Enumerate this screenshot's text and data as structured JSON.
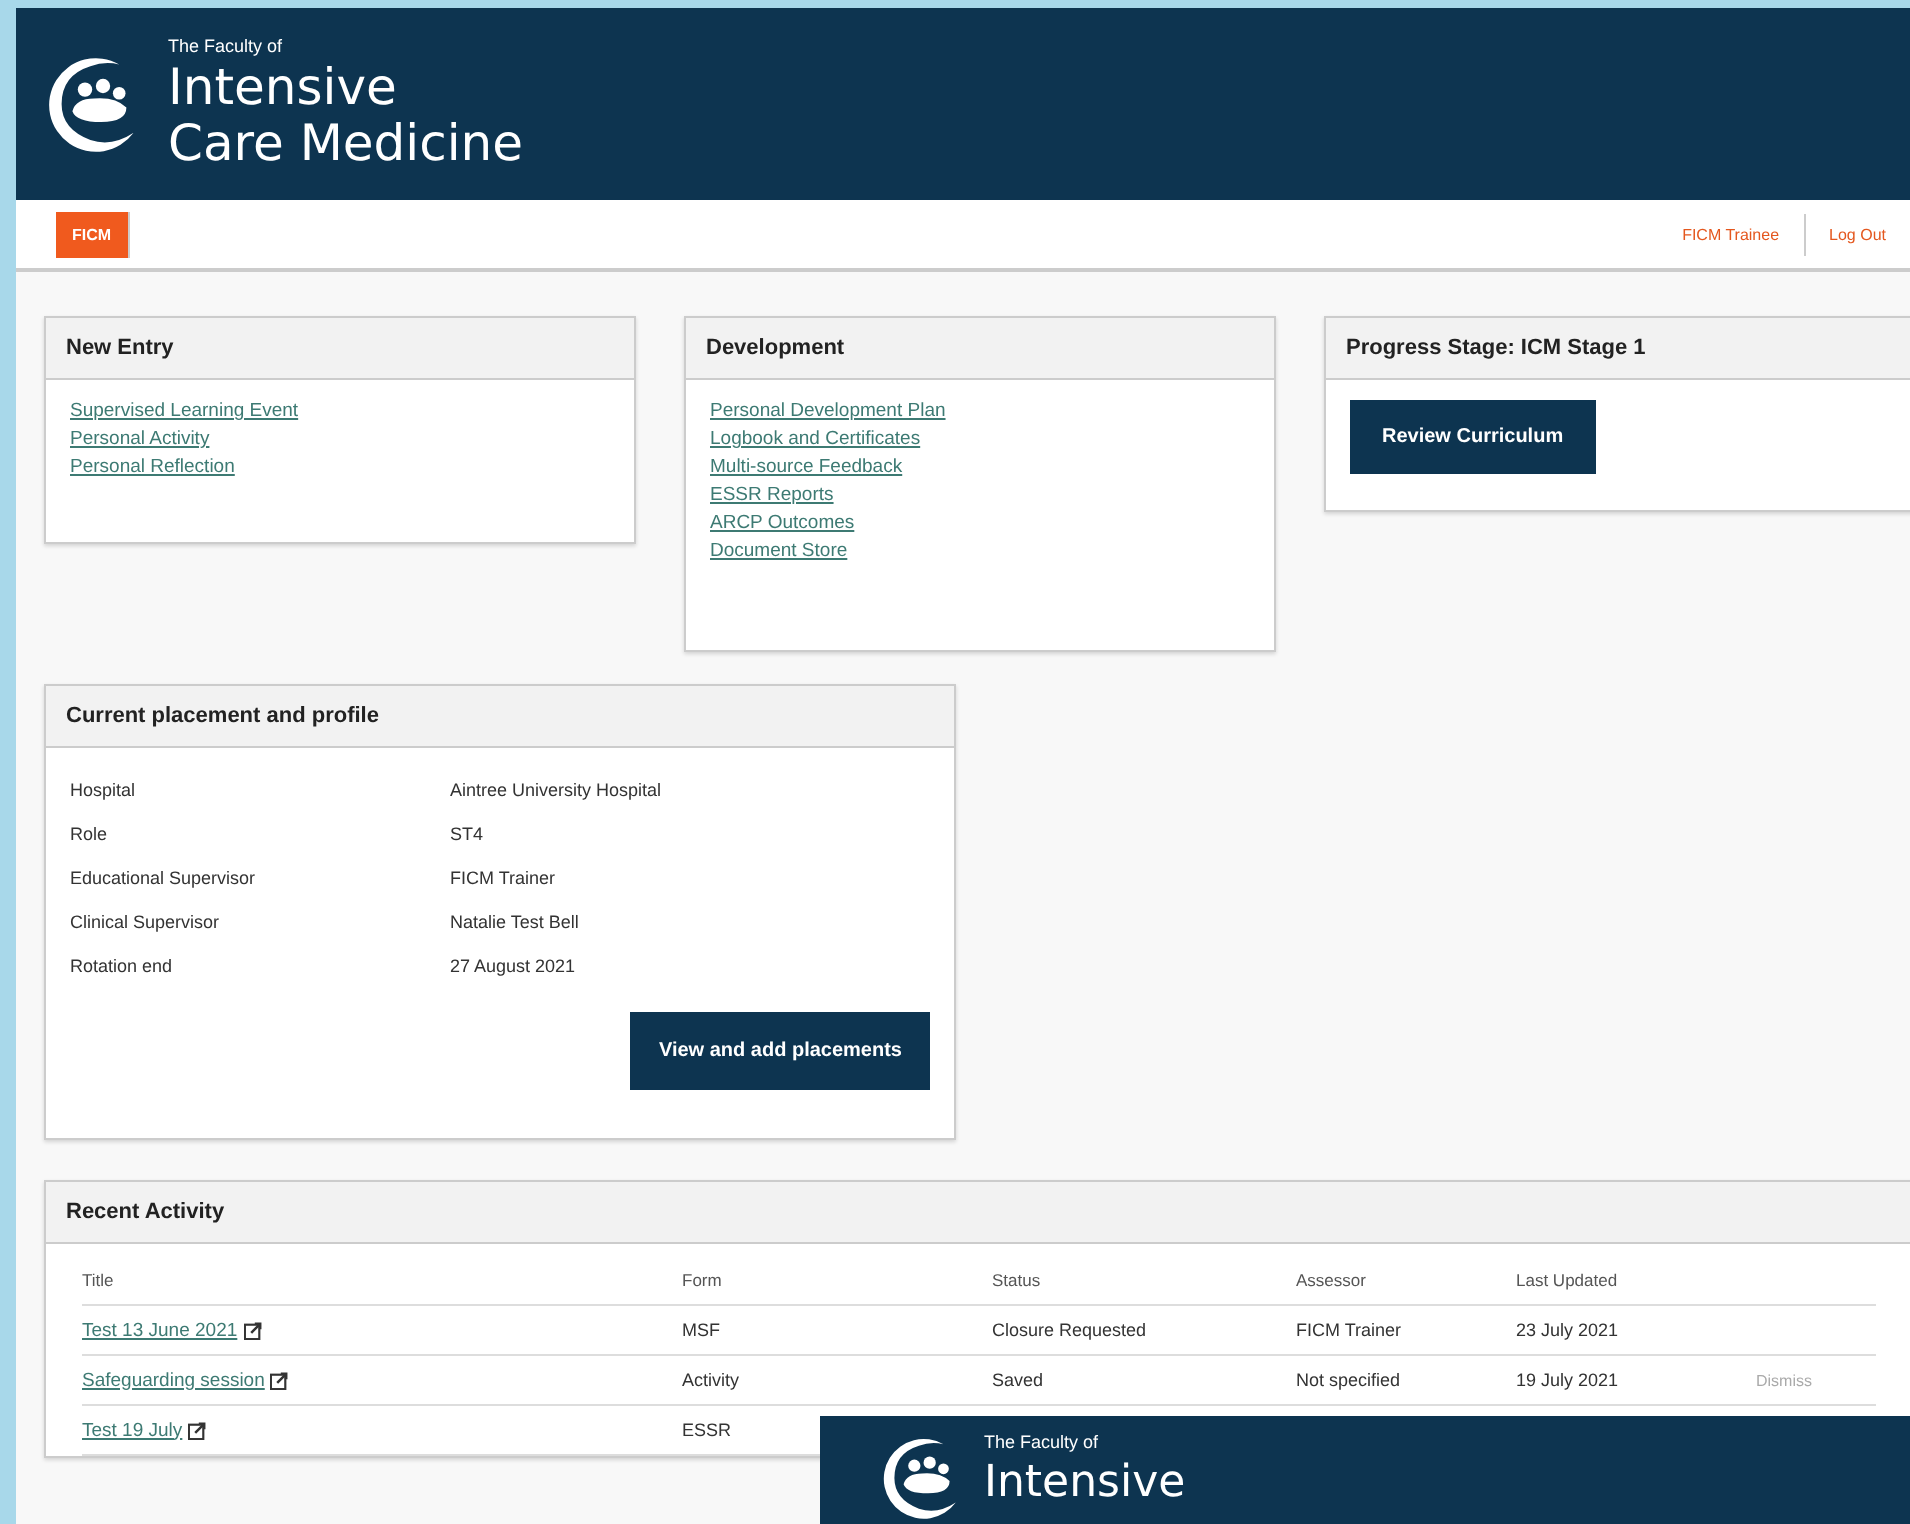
{
  "header": {
    "logo_small": "The Faculty of",
    "logo_line1": "Intensive",
    "logo_line2": "Care Medicine"
  },
  "nav": {
    "tabs": [
      {
        "label": "FICM",
        "selected": true
      }
    ],
    "links": [
      "FICM Trainee",
      "Log Out"
    ]
  },
  "new_entry": {
    "title": "New Entry",
    "links": [
      "Supervised Learning Event",
      "Personal Activity",
      "Personal Reflection"
    ]
  },
  "development": {
    "title": "Development",
    "links": [
      "Personal Development Plan",
      "Logbook and Certificates",
      "Multi-source Feedback",
      "ESSR Reports",
      "ARCP Outcomes",
      "Document Store"
    ]
  },
  "progress": {
    "title": "Progress Stage: ICM Stage 1",
    "button": "Review Curriculum"
  },
  "placement": {
    "title": "Current placement and profile",
    "rows": [
      {
        "label": "Hospital",
        "value": "Aintree University Hospital"
      },
      {
        "label": "Role",
        "value": "ST4"
      },
      {
        "label": "Educational Supervisor",
        "value": "FICM Trainer"
      },
      {
        "label": "Clinical Supervisor",
        "value": "Natalie Test Bell"
      },
      {
        "label": "Rotation end",
        "value": "27 August 2021"
      }
    ],
    "button": "View and add placements"
  },
  "recent_activity": {
    "title": "Recent Activity",
    "columns": [
      "Title",
      "Form",
      "Status",
      "Assessor",
      "Last Updated"
    ],
    "rows": [
      {
        "title": "Test 13 June 2021",
        "form": "MSF",
        "status": "Closure Requested",
        "assessor": "FICM Trainer",
        "updated": "23 July 2021"
      },
      {
        "title": "Safeguarding session",
        "form": "Activity",
        "status": "Saved",
        "assessor": "Not specified",
        "updated": "19 July 2021",
        "action": "Dismiss"
      },
      {
        "title": "Test 19 July",
        "form": "ESSR"
      }
    ]
  },
  "overlay": {
    "logo_small": "The Faculty of",
    "logo_line1": "Intensive"
  }
}
